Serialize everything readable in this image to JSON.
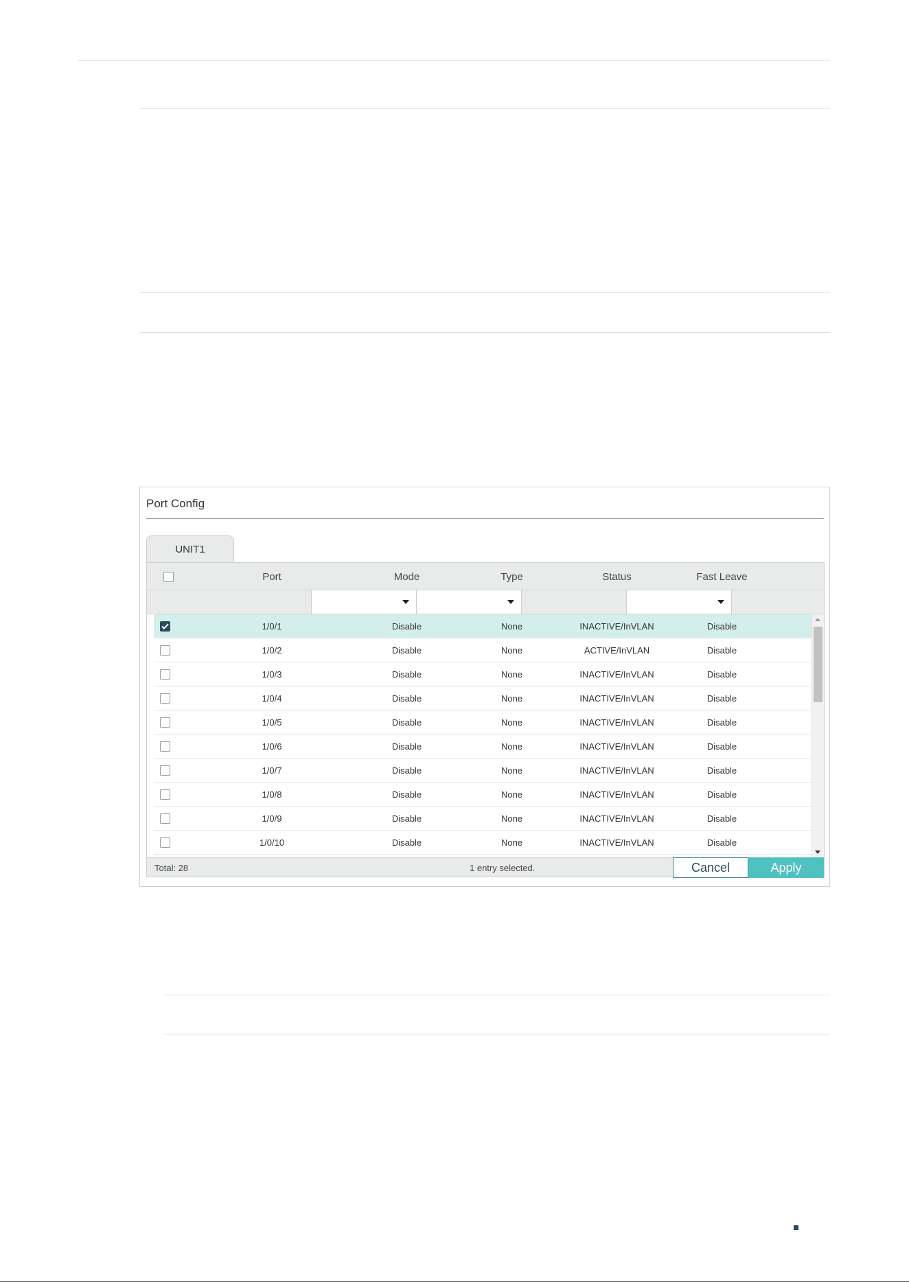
{
  "panel": {
    "title": "Port Config",
    "tab": "UNIT1"
  },
  "table": {
    "headers": {
      "port": "Port",
      "mode": "Mode",
      "type": "Type",
      "status": "Status",
      "fast_leave": "Fast Leave"
    },
    "rows": [
      {
        "checked": true,
        "port": "1/0/1",
        "mode": "Disable",
        "type": "None",
        "status": "INACTIVE/InVLAN",
        "fast_leave": "Disable"
      },
      {
        "checked": false,
        "port": "1/0/2",
        "mode": "Disable",
        "type": "None",
        "status": "ACTIVE/InVLAN",
        "fast_leave": "Disable"
      },
      {
        "checked": false,
        "port": "1/0/3",
        "mode": "Disable",
        "type": "None",
        "status": "INACTIVE/InVLAN",
        "fast_leave": "Disable"
      },
      {
        "checked": false,
        "port": "1/0/4",
        "mode": "Disable",
        "type": "None",
        "status": "INACTIVE/InVLAN",
        "fast_leave": "Disable"
      },
      {
        "checked": false,
        "port": "1/0/5",
        "mode": "Disable",
        "type": "None",
        "status": "INACTIVE/InVLAN",
        "fast_leave": "Disable"
      },
      {
        "checked": false,
        "port": "1/0/6",
        "mode": "Disable",
        "type": "None",
        "status": "INACTIVE/InVLAN",
        "fast_leave": "Disable"
      },
      {
        "checked": false,
        "port": "1/0/7",
        "mode": "Disable",
        "type": "None",
        "status": "INACTIVE/InVLAN",
        "fast_leave": "Disable"
      },
      {
        "checked": false,
        "port": "1/0/8",
        "mode": "Disable",
        "type": "None",
        "status": "INACTIVE/InVLAN",
        "fast_leave": "Disable"
      },
      {
        "checked": false,
        "port": "1/0/9",
        "mode": "Disable",
        "type": "None",
        "status": "INACTIVE/InVLAN",
        "fast_leave": "Disable"
      },
      {
        "checked": false,
        "port": "1/0/10",
        "mode": "Disable",
        "type": "None",
        "status": "INACTIVE/InVLAN",
        "fast_leave": "Disable"
      }
    ]
  },
  "footer": {
    "total": "Total: 28",
    "selected": "1 entry selected.",
    "cancel_label": "Cancel",
    "apply_label": "Apply"
  },
  "icons": {
    "check": "check-icon",
    "dropdown": "chevron-down-icon",
    "scroll_up": "scroll-up-icon",
    "scroll_down": "scroll-down-icon"
  },
  "colors": {
    "accent": "#4fc2c0",
    "selected_row": "#d3efeb",
    "checkbox_checked": "#2d4a5a"
  }
}
